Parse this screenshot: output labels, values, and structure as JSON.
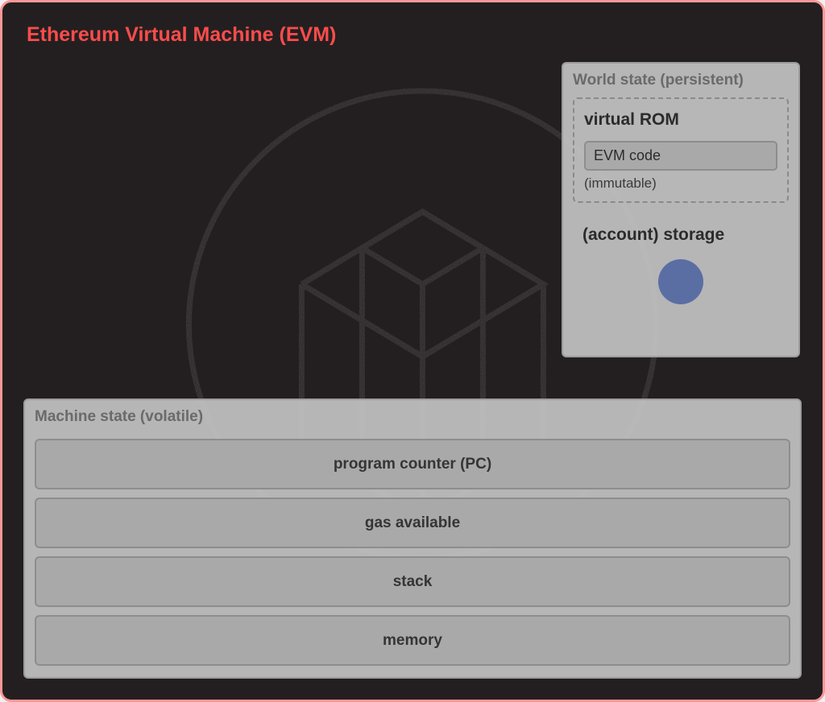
{
  "title": "Ethereum Virtual Machine (EVM)",
  "world_state": {
    "panel_title": "World state (persistent)",
    "virtual_rom": {
      "title": "virtual ROM",
      "evm_code": "EVM code",
      "immutable": "(immutable)"
    },
    "account_storage": {
      "title": "(account) storage"
    }
  },
  "machine_state": {
    "panel_title": "Machine state (volatile)",
    "items": [
      "program counter (PC)",
      "gas available",
      "stack",
      "memory"
    ]
  },
  "colors": {
    "accent": "#fc4c4c",
    "border": "#fd9797",
    "storage_dot": "#5b6ea3"
  }
}
